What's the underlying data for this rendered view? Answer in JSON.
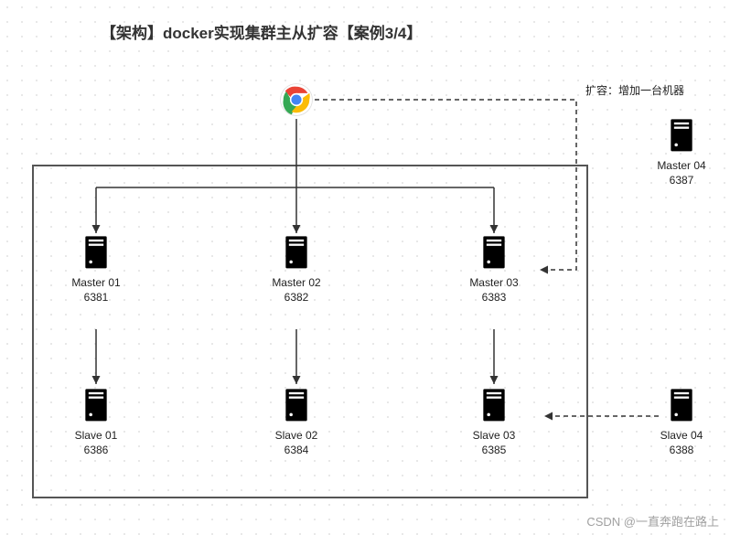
{
  "title": "【架构】docker实现集群主从扩容【案例3/4】",
  "annotation": "扩容：增加一台机器",
  "watermark": "CSDN @一直奔跑在路上",
  "nodes": {
    "master01": {
      "label": "Master 01",
      "port": "6381"
    },
    "master02": {
      "label": "Master 02",
      "port": "6382"
    },
    "master03": {
      "label": "Master 03",
      "port": "6383"
    },
    "master04": {
      "label": "Master 04",
      "port": "6387"
    },
    "slave01": {
      "label": "Slave 01",
      "port": "6386"
    },
    "slave02": {
      "label": "Slave 02",
      "port": "6384"
    },
    "slave03": {
      "label": "Slave 03",
      "port": "6385"
    },
    "slave04": {
      "label": "Slave 04",
      "port": "6388"
    }
  },
  "chart_data": {
    "type": "diagram",
    "title": "【架构】docker实现集群主从扩容【案例3/4】",
    "root": {
      "name": "Chrome client"
    },
    "cluster": [
      {
        "master": {
          "name": "Master 01",
          "port": 6381
        },
        "slave": {
          "name": "Slave 01",
          "port": 6386
        }
      },
      {
        "master": {
          "name": "Master 02",
          "port": 6382
        },
        "slave": {
          "name": "Slave 02",
          "port": 6384
        }
      },
      {
        "master": {
          "name": "Master 03",
          "port": 6383
        },
        "slave": {
          "name": "Slave 03",
          "port": 6385
        }
      }
    ],
    "expansion": {
      "annotation": "扩容：增加一台机器",
      "new_master": {
        "name": "Master 04",
        "port": 6387
      },
      "new_slave": {
        "name": "Slave 04",
        "port": 6388
      },
      "dashed_links": [
        {
          "from": "Chrome client",
          "to": "Master 04"
        },
        {
          "from": "Slave 04",
          "to": "Slave 03"
        }
      ]
    },
    "solid_links": [
      {
        "from": "Chrome client",
        "to": "Master 01"
      },
      {
        "from": "Chrome client",
        "to": "Master 02"
      },
      {
        "from": "Chrome client",
        "to": "Master 03"
      },
      {
        "from": "Master 01",
        "to": "Slave 01"
      },
      {
        "from": "Master 02",
        "to": "Slave 02"
      },
      {
        "from": "Master 03",
        "to": "Slave 03"
      }
    ]
  }
}
